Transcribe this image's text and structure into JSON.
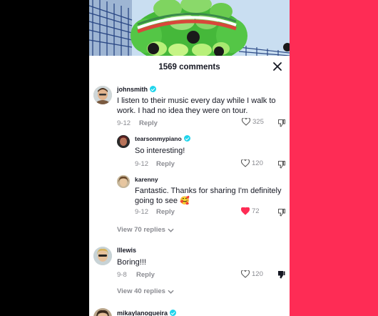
{
  "comments_sheet": {
    "title": "1569 comments"
  },
  "comments": [
    {
      "username": "johnsmith",
      "text_line1": "I listen to their music every day while I walk to",
      "text_line2": "work. I had no idea they were on tour.",
      "date": "9-12",
      "reply_label": "Reply",
      "likes": "325"
    },
    {
      "username": "tearsonmypiano",
      "text_line1": "So interesting!",
      "date": "9-12",
      "reply_label": "Reply",
      "likes": "120"
    },
    {
      "username": "karenny",
      "text_line1": "Fantastic. Thanks for sharing I'm definitely",
      "text_line2": "going to see 🥰",
      "date": "9-12",
      "reply_label": "Reply",
      "likes": "72"
    },
    {
      "username": "lllewis",
      "text_line1": "Boring!!!",
      "date": "9-8",
      "reply_label": "Reply",
      "likes": "120"
    },
    {
      "username": "mikaylanogueira"
    }
  ],
  "view_replies": [
    {
      "label": "View 70 replies"
    },
    {
      "label": "View 40 replies"
    }
  ],
  "colors": {
    "accent": "#fe2c55",
    "verified": "#20d5ec",
    "liked_heart": "#fe2c55"
  },
  "icons": {
    "close": "close-icon",
    "heart": "heart-icon",
    "dislike": "thumbs-down-icon",
    "verified": "verified-badge-icon",
    "chevron": "chevron-down-icon"
  }
}
